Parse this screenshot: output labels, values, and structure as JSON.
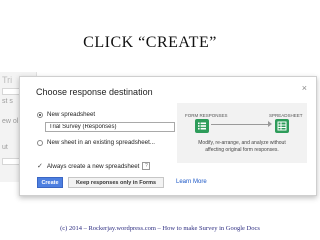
{
  "slide": {
    "title": "CLICK “CREATE”",
    "footer": "(c) 2014 – Rockerjay.wordpress.com – How to make Survey in Google Docs"
  },
  "background": {
    "fragments": [
      "Tri",
      "",
      "st s",
      "ew ol",
      "ut"
    ]
  },
  "dialog": {
    "title": "Choose response destination",
    "close_label": "×",
    "options": [
      {
        "label": "New spreadsheet",
        "selected": true
      },
      {
        "label": "New sheet in an existing spreadsheet...",
        "selected": false
      }
    ],
    "spreadsheet_name": "Trial Survey (Responses)",
    "always_create_label": "Always create a new spreadsheet",
    "always_create_checked": true,
    "help_icon_label": "?",
    "create_button": "Create",
    "keep_button": "Keep responses only in Forms",
    "learn_more": "Learn More"
  },
  "illustration": {
    "left_label": "FORM RESPONSES",
    "right_label": "SPREADSHEET",
    "description_line1": "Modify, re-arrange, and analyze without",
    "description_line2": "affecting original form responses.",
    "icon_color": "#2e9c5a"
  },
  "colors": {
    "primary_button": "#4d7fe0",
    "link": "#1a56c6",
    "footer_text": "#2d2d80"
  }
}
